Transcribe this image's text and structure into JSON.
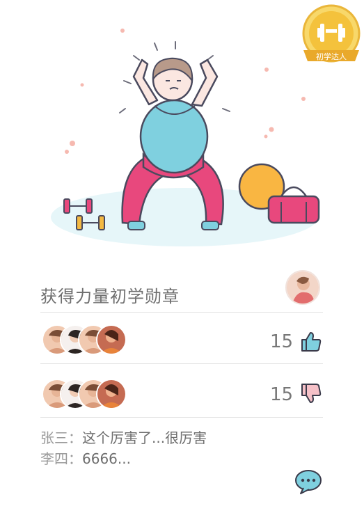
{
  "badge": {
    "label": "初学达人"
  },
  "achievement": {
    "title": "获得力量初学勋章"
  },
  "likes": {
    "count": "15"
  },
  "dislikes": {
    "count": "15"
  },
  "comments": [
    {
      "user": "张三",
      "separator": "：",
      "text": "这个厉害了...很厉害"
    },
    {
      "user": "李四",
      "separator": "：",
      "text": "6666..."
    }
  ],
  "colors": {
    "accent_blue": "#7fd0df",
    "accent_pink": "#e8487d",
    "badge_gold": "#f4c23c",
    "text_gray": "#6f6f6f"
  },
  "icons": {
    "like": "thumbs-up-icon",
    "dislike": "thumbs-down-icon",
    "comment": "chat-bubble-icon",
    "badge": "dumbbell-badge-icon"
  }
}
